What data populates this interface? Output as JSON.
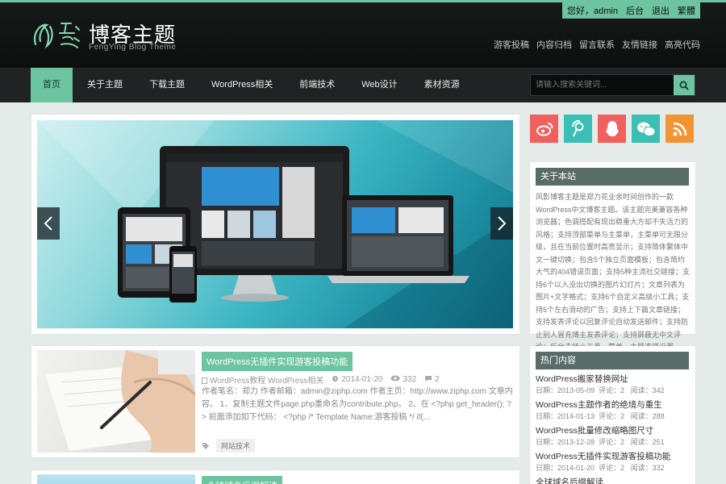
{
  "header": {
    "user_greeting": "您好，admin",
    "backend": "后台",
    "logout": "退出",
    "traditional": "繁體",
    "site_title": "博客主题",
    "site_subtitle": "FengYing Blog Theme",
    "top_links": [
      "游客投稿",
      "内容归档",
      "留言联系",
      "友情链接",
      "高亮代码"
    ]
  },
  "nav": {
    "items": [
      "首页",
      "关于主题",
      "下载主题",
      "WordPress相关",
      "前端技术",
      "Web设计",
      "素材资源"
    ],
    "search_placeholder": "请输入搜索关键词..."
  },
  "slider": {},
  "post": {
    "title": "WordPress无插件实现游客投稿功能",
    "categories": "WordPress教程 WordPress相关",
    "date": "2014-01-20",
    "views": "332",
    "comments": "2",
    "excerpt": "作者笔名：郑力 作者邮箱：admin@ziphp.com 作者主页：http://www.ziphp.com 文章内容。 1、复制主题文件page.php重命名为contribute.php。 2、在 <?php get_header(); ?> 前面添加如下代码： <?php  /* Template Name:游客投稿  */  if(...",
    "tag": "网站技术"
  },
  "post2": {
    "title": "全球域名后缀解读"
  },
  "sidebar": {
    "social_icons": [
      "weibo-icon",
      "tencent-weibo-icon",
      "qq-icon",
      "wechat-icon",
      "rss-icon"
    ],
    "colors": {
      "accent": "#6cc4a0",
      "weibo": "#f0605c",
      "tencent": "#3bbfb4",
      "qq": "#f0605c",
      "wechat": "#3bbfb4",
      "rss": "#f39434"
    },
    "about_title": "关于本站",
    "about_text": "风影博客主题是郑力花业余时间创作的一款WordPress中文博客主题。该主题完美兼容各种浏览器；色调搭配有现出稳重大方却不失活力的风格；支持顶部菜单与主菜单，主菜单可无限分级，且在当前位置时高亮显示；支持简体繁体中文一键切换；包含5个独立页面模板；包含简约大气的404错误页面；支持5种主流社交链接；支持6个以入没出切换的图片幻灯片；文章列表为图片+文字格式；支持6个自定义高级小工具；支持5个左右滑动的广告；支持上下篇文章链接；支持发表评论以回复评论自动发送邮件；支持防止别人冒充博主发表评论；支持屏蔽无中文评论；后台支持小工具、菜单、主题选项设置。",
    "hot_title": "热门内容",
    "hot_items": [
      {
        "title": "WordPress搬家替换网址",
        "date": "2013-05-09",
        "comments": "2",
        "views": "342"
      },
      {
        "title": "WordPress主题作者的绝境与重生",
        "date": "2014-01-13",
        "comments": "2",
        "views": "288"
      },
      {
        "title": "WordPress批量修改缩略图尺寸",
        "date": "2013-12-28",
        "comments": "2",
        "views": "251"
      },
      {
        "title": "WordPress无插件实现游客投稿功能",
        "date": "2014-01-20",
        "comments": "2",
        "views": "332"
      },
      {
        "title": "全球域名后缀解读",
        "date": "",
        "comments": "",
        "views": ""
      }
    ],
    "labels": {
      "date": "日期：",
      "comments": "评论：",
      "views": "阅读："
    }
  }
}
